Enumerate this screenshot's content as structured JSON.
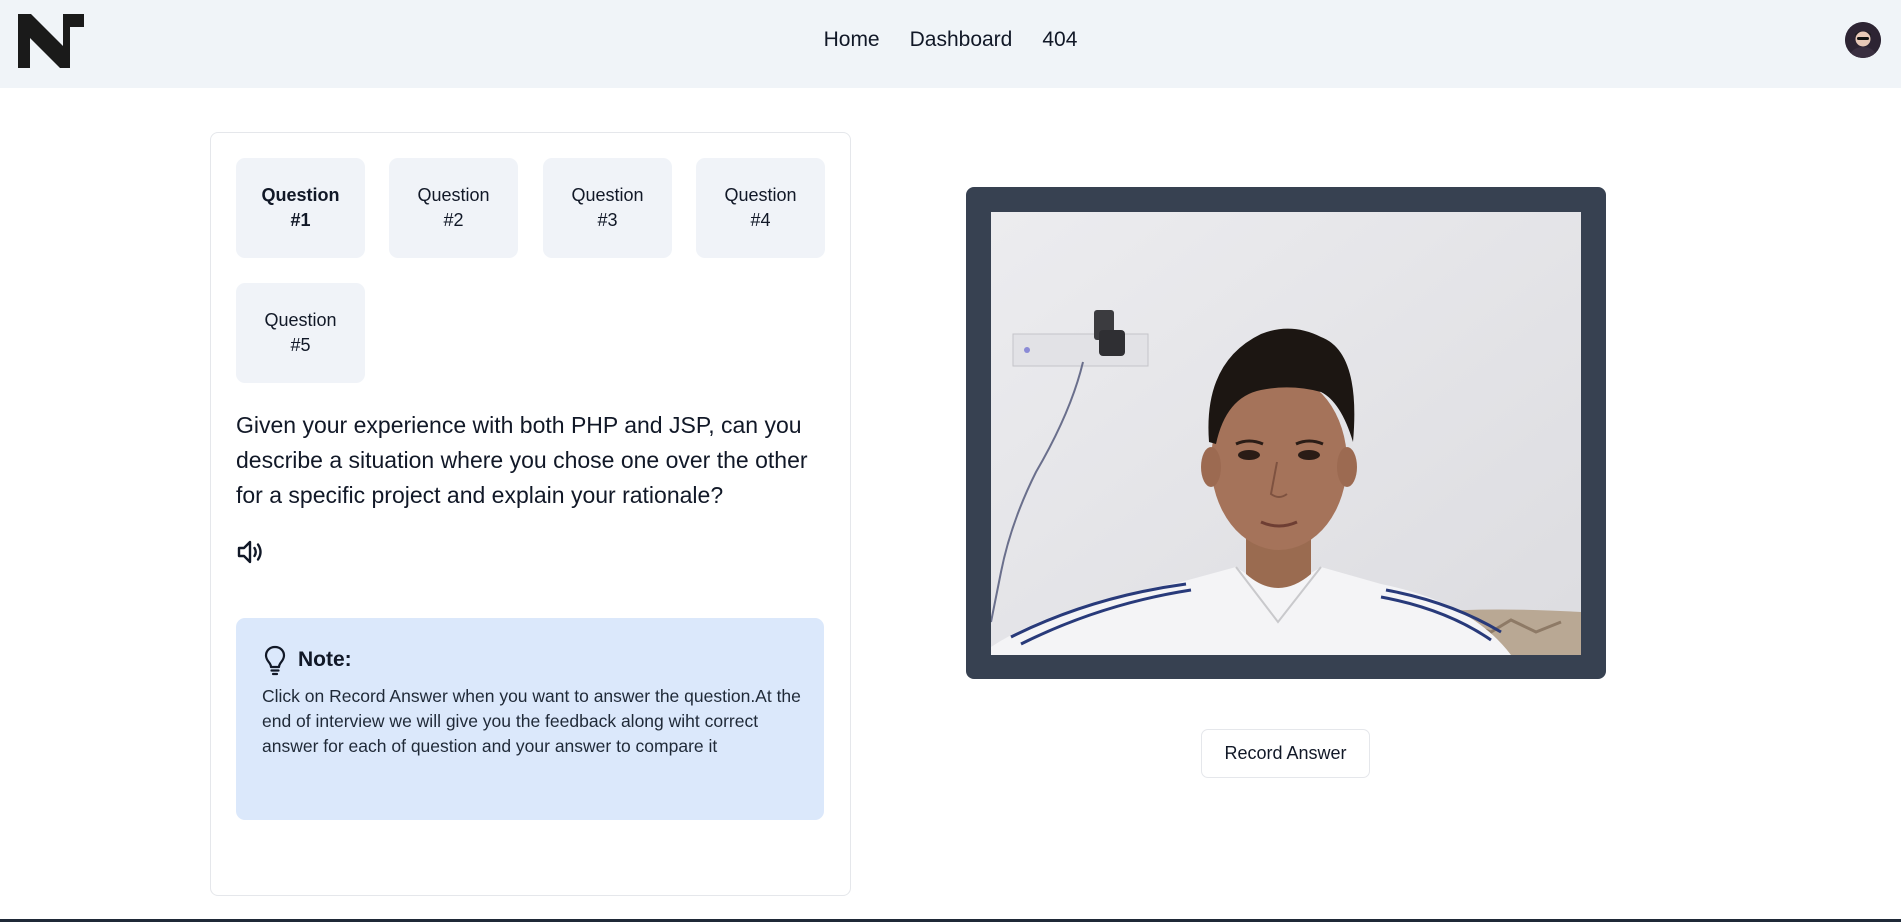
{
  "header": {
    "nav": [
      "Home",
      "Dashboard",
      "404"
    ]
  },
  "questions": [
    {
      "line1": "Question",
      "line2": "#1",
      "active": true
    },
    {
      "line1": "Question",
      "line2": "#2",
      "active": false
    },
    {
      "line1": "Question",
      "line2": "#3",
      "active": false
    },
    {
      "line1": "Question",
      "line2": "#4",
      "active": false
    },
    {
      "line1": "Question",
      "line2": "#5",
      "active": false
    }
  ],
  "question_text": "Given your experience with both PHP and JSP, can you describe a situation where you chose one over the other for a specific project and explain your rationale?",
  "note": {
    "title": "Note:",
    "body": "Click on Record Answer when you want to answer the question.At the end of interview we will give you the feedback along wiht correct answer for each of question and your answer to compare it"
  },
  "record_button": "Record Answer",
  "icons": {
    "logo": "brand-logo",
    "avatar": "user-avatar",
    "speaker": "speaker-icon",
    "note": "lightbulb-icon"
  },
  "colors": {
    "header_bg": "#f0f4f8",
    "question_btn_bg": "#f0f3f8",
    "note_bg": "#dbe8fb",
    "camera_frame": "#374151"
  }
}
